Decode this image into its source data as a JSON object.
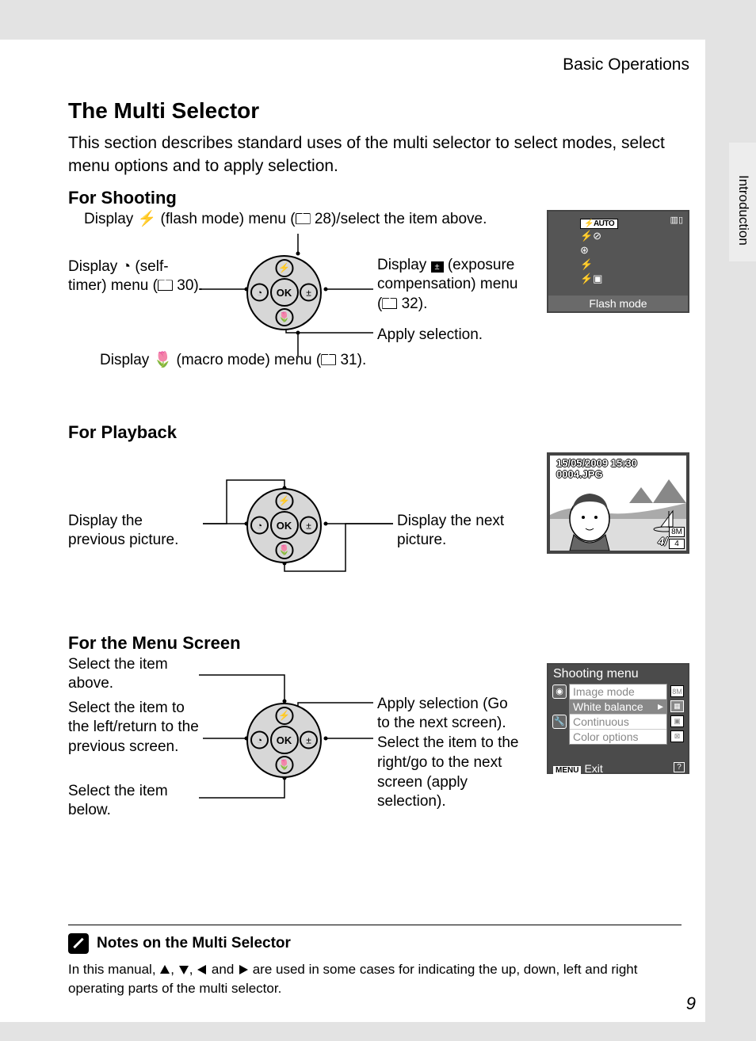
{
  "running_head": "Basic Operations",
  "side_tab": "Introduction",
  "title": "The Multi Selector",
  "intro": "This section describes standard uses of the multi selector to select modes, select menu options and to apply selection.",
  "page_number": "9",
  "dial": {
    "ok": "OK"
  },
  "shoot": {
    "heading": "For Shooting",
    "top_pre": "Display ",
    "top_post": " (flash mode) menu (",
    "top_page": " 28)/select the item above.",
    "left_pre": "Display ",
    "left_mid": " (self-timer) menu (",
    "left_page": " 30).",
    "right_pre": "Display ",
    "right_mid": " (exposure compensation) menu (",
    "right_page": " 32).",
    "apply": "Apply selection.",
    "bottom_pre": "Display ",
    "bottom_mid": " (macro mode) menu (",
    "bottom_page": " 31).",
    "flash_header": "AUTO",
    "flash_caption": "Flash mode"
  },
  "play": {
    "heading": "For Playback",
    "left": "Display the previous picture.",
    "right": "Display the next picture.",
    "date": "15/05/2009 15:30",
    "file": "0004.JPG",
    "counter": "4/",
    "badge1": "8M",
    "badge2": "4"
  },
  "menu": {
    "heading": "For the Menu Screen",
    "above": "Select the item above.",
    "left": "Select the item to the left/return to the previous screen.",
    "below": "Select the item below.",
    "apply": "Apply selection (Go to the next screen).",
    "right": "Select the item to the right/go to the next screen (apply selection).",
    "thumb_title": "Shooting menu",
    "items": [
      "Image mode",
      "White balance",
      "Continuous",
      "Color options"
    ],
    "exit_btn": "MENU",
    "exit": "Exit",
    "help": "?"
  },
  "notes": {
    "title": "Notes on the Multi Selector",
    "pre": "In this manual, ",
    "sep": ", ",
    "and": " and ",
    "post": " are used in some cases for indicating the up, down, left and right operating parts of the multi selector."
  }
}
